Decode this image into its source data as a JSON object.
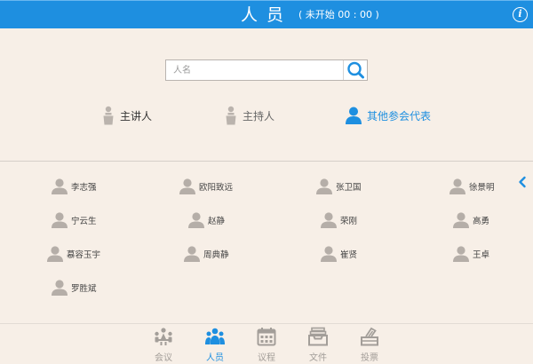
{
  "header": {
    "title": "人员",
    "status": "( 未开始 00 : 00 )",
    "info_label": "i"
  },
  "search": {
    "placeholder": "人名"
  },
  "roles": [
    {
      "label": "主讲人",
      "selected": false
    },
    {
      "label": "主持人",
      "selected": false
    },
    {
      "label": "其他参会代表",
      "selected": true
    }
  ],
  "participants": [
    "李志强",
    "欧阳致远",
    "张卫国",
    "徐景明",
    "宁云生",
    "赵静",
    "荣刚",
    "高勇",
    "慕容玉宇",
    "周典静",
    "崔贤",
    "王卓",
    "罗胜斌"
  ],
  "nav": [
    {
      "label": "会议",
      "icon": "meeting-icon",
      "active": false
    },
    {
      "label": "人员",
      "icon": "people-icon",
      "active": true
    },
    {
      "label": "议程",
      "icon": "calendar-icon",
      "active": false
    },
    {
      "label": "文件",
      "icon": "file-tray-icon",
      "active": false
    },
    {
      "label": "投票",
      "icon": "vote-icon",
      "active": false
    }
  ],
  "colors": {
    "accent": "#1e8fe0",
    "background": "#f7efe7",
    "inactive": "#a39e99",
    "avatar": "#b5aea8"
  }
}
